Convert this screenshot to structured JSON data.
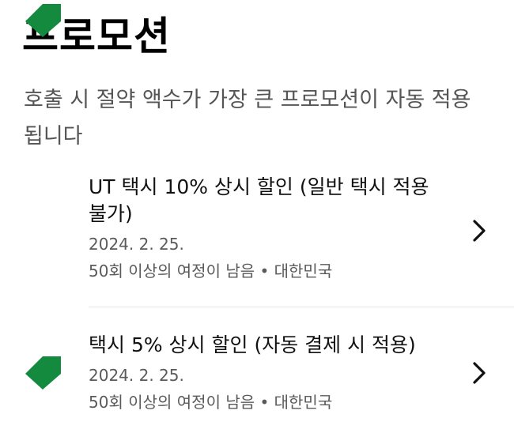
{
  "header": {
    "title": "프로모션",
    "description": "호출 시 절약 액수가 가장 큰 프로모션이 자동 적용됩니다"
  },
  "promotions": [
    {
      "title": "UT 택시 10% 상시 할인 (일반 택시 적용 불가)",
      "date": "2024. 2. 25.",
      "details": "50회 이상의 여정이 남음 • 대한민국",
      "icon": "tag-icon",
      "action_icon": "chevron-right-icon"
    },
    {
      "title": "택시 5% 상시 할인 (자동 결제 시 적용)",
      "date": "2024. 2. 25.",
      "details": "50회 이상의 여정이 남음 • 대한민국",
      "icon": "tag-icon",
      "action_icon": "chevron-right-icon"
    }
  ],
  "colors": {
    "tag": "#148a3f",
    "text_primary": "#111111",
    "text_secondary": "#5a5a5a",
    "divider": "#e6e6e6"
  }
}
